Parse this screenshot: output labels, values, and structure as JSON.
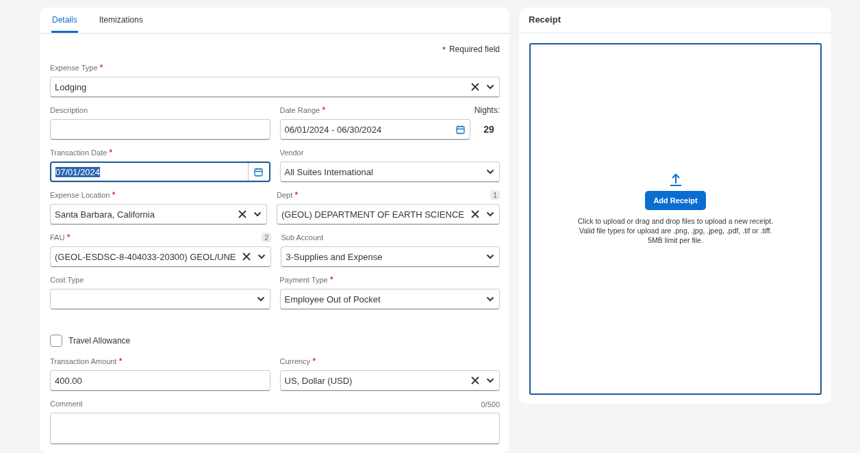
{
  "tabs": [
    {
      "label": "Details",
      "selected": true
    },
    {
      "label": "Itemizations",
      "selected": false
    }
  ],
  "required_note": {
    "mark": "*",
    "text": "Required field"
  },
  "form_rows": [
    {
      "kind": "fields",
      "fields": [
        {
          "kind": "select",
          "label": "Expense Type",
          "required": true,
          "value": "Lodging",
          "clearable": true
        }
      ]
    },
    {
      "kind": "fields",
      "fields": [
        {
          "kind": "text",
          "label": "Description",
          "required": false
        },
        {
          "kind": "daterange",
          "label": "Date Range",
          "required": true,
          "value": "06/01/2024 - 06/30/2024",
          "nights": {
            "label": "Nights:",
            "value": "29"
          }
        }
      ]
    },
    {
      "kind": "fields",
      "fields": [
        {
          "kind": "date",
          "label": "Transaction Date",
          "required": true,
          "value": "07/01/2024",
          "focused": true,
          "text_selected": true
        },
        {
          "kind": "select",
          "label": "Vendor",
          "required": false,
          "value": "All Suites International",
          "clearable": false
        }
      ]
    },
    {
      "kind": "fields",
      "fields": [
        {
          "kind": "select",
          "label": "Expense Location",
          "required": true,
          "value": "Santa Barbara, California",
          "clearable": true
        },
        {
          "kind": "select",
          "label": "Dept",
          "required": true,
          "badge": "1",
          "value": "(GEOL) DEPARTMENT OF EARTH SCIENCE",
          "clearable": true
        }
      ]
    },
    {
      "kind": "fields",
      "fields": [
        {
          "kind": "select",
          "label": "FAU",
          "required": true,
          "badge": "2",
          "value": "(GEOL-ESDSC-8-404033-20300) GEOL/UNE",
          "clearable": true
        },
        {
          "kind": "select",
          "label": "Sub Account",
          "required": false,
          "value": "3-Supplies and Expense",
          "clearable": false
        }
      ]
    },
    {
      "kind": "fields",
      "fields": [
        {
          "kind": "select",
          "label": "Cost Type",
          "required": false,
          "clearable": false
        },
        {
          "kind": "select",
          "label": "Payment Type",
          "required": true,
          "value": "Employee Out of Pocket",
          "clearable": false
        }
      ]
    },
    {
      "kind": "checkbox",
      "label": "Travel Allowance",
      "checked": false
    },
    {
      "kind": "fields",
      "fields": [
        {
          "kind": "text",
          "label": "Transaction Amount",
          "required": true,
          "value": "400.00"
        },
        {
          "kind": "select",
          "label": "Currency",
          "required": true,
          "value": "US, Dollar (USD)",
          "clearable": true
        }
      ]
    },
    {
      "kind": "fields",
      "fields": [
        {
          "kind": "textarea",
          "label": "Comment",
          "required": false,
          "counter": "0/500"
        }
      ]
    }
  ],
  "receipt": {
    "title": "Receipt",
    "button": "Add Receipt",
    "hint_lines": [
      "Click to upload or drag and drop files to upload a new receipt.",
      "Valid file types for upload are .png, .jpg, .jpeg, .pdf, .tif or .tiff.",
      "5MB limit per file."
    ]
  }
}
